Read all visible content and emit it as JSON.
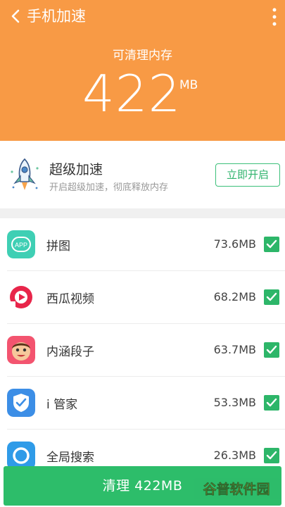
{
  "header": {
    "title": "手机加速",
    "free_label": "可清理内存",
    "free_value": "422",
    "free_unit": "MB",
    "color": "#f89a45"
  },
  "boost": {
    "title": "超级加速",
    "subtitle": "开启超级加速，彻底释放内存",
    "button": "立即开启"
  },
  "apps": [
    {
      "name": "拼图",
      "size": "73.6MB",
      "checked": true
    },
    {
      "name": "西瓜视频",
      "size": "68.2MB",
      "checked": true
    },
    {
      "name": "内涵段子",
      "size": "63.7MB",
      "checked": true
    },
    {
      "name": "i 管家",
      "size": "53.3MB",
      "checked": true
    },
    {
      "name": "全局搜索",
      "size": "26.3MB",
      "checked": true
    }
  ],
  "clean_button": "清理 422MB",
  "watermark": "谷普软件园",
  "accent": "#2db669"
}
